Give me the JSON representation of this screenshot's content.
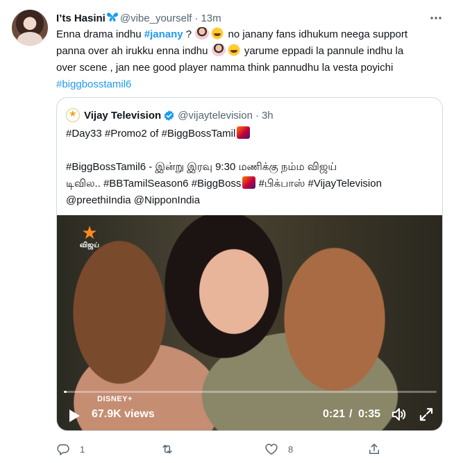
{
  "tweet": {
    "author_name": "I’ts Hasini",
    "author_emoji": "butterfly-icon",
    "handle": "@vibe_yourself",
    "separator": "·",
    "time": "13m",
    "more": "···",
    "lines": [
      {
        "a": "Enna drama indhu ",
        "tag": "#janany",
        "b": " ? ",
        "c": " no janany fans idhukum neega support"
      },
      {
        "a": "panna over ah irukku enna indhu ",
        "b": " yarume eppadi la pannule indhu la"
      },
      {
        "a": "over scene , jan nee good player namma think pannudhu la vesta poyichi"
      },
      {
        "tag": "#biggbosstamil6"
      }
    ]
  },
  "quote": {
    "name": "Vijay Television",
    "handle": "@vijaytelevision",
    "separator": "·",
    "time": "3h",
    "line1_tags": "#Day33 #Promo2 of #BiggBossTamil",
    "line2": "#BiggBossTamil6 - இன்று இரவு 9:30 மணிக்கு நம்ம விஜய்",
    "line3_a": "டிவில.. #BBTamilSeason6 #BiggBoss",
    "line3_b": " #பிக்பாஸ் #VijayTelevision",
    "line4": "@preethiIndia  @NipponIndia",
    "video": {
      "channel_logo_text": "விஜய்",
      "disney_text": "DISNEY+",
      "views": "67.9K views",
      "elapsed": "0:21",
      "slash": "/",
      "total": "0:35",
      "progress_fraction": 0.008
    }
  },
  "actions": {
    "reply_count": "1",
    "retweet_count": "",
    "like_count": "8",
    "share_count": ""
  },
  "colors": {
    "accent": "#1d9bf0",
    "muted": "#536471",
    "text": "#0f1419",
    "border": "#cfd9de"
  }
}
